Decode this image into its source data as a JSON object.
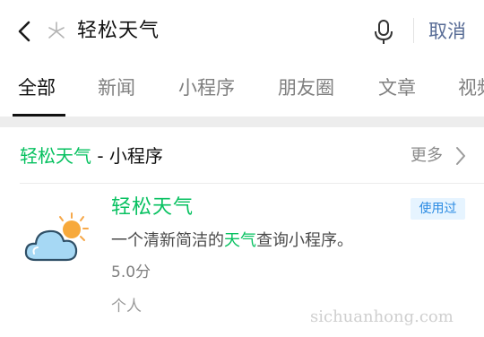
{
  "search": {
    "back_icon": "chevron-left-icon",
    "logo_icon": "wechat-search-icon",
    "query": "轻松天气",
    "mic_icon": "microphone-icon",
    "cancel_label": "取消"
  },
  "tabs": [
    {
      "label": "全部",
      "active": true
    },
    {
      "label": "新闻"
    },
    {
      "label": "小程序"
    },
    {
      "label": "朋友圈"
    },
    {
      "label": "文章"
    },
    {
      "label": "视频"
    }
  ],
  "section": {
    "title_highlight": "轻松天气",
    "title_rest": " - 小程序",
    "more_label": "更多"
  },
  "result": {
    "icon": "weather-partly-cloudy-icon",
    "name": "轻松天气",
    "badge": "使用过",
    "desc_before": "一个清新简洁的",
    "desc_highlight": "天气",
    "desc_after": "查询小程序。",
    "rating": "5.0分",
    "owner": "个人"
  },
  "watermark": "sichuanhong.com",
  "colors": {
    "highlight": "#07c160",
    "cancel": "#576b95",
    "badge_text": "#2b8be3",
    "badge_bg": "#e6f4ff"
  }
}
